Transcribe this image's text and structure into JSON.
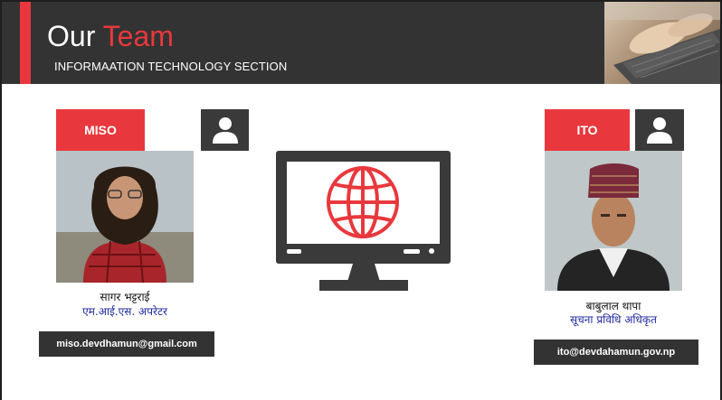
{
  "header": {
    "title_part1": "Our",
    "title_part2": "Team",
    "subtitle": "INFORMAATION TECHNOLOGY SECTION",
    "accent_color": "#e8383d",
    "background_color": "#333333"
  },
  "center_graphic": {
    "icon": "monitor-globe-icon"
  },
  "members": [
    {
      "role": "MISO",
      "icon": "user-icon",
      "name": "सागर भट्टराई",
      "designation": "एम.आई.एस. अपरेटर",
      "email": "miso.devdhamun@gmail.com"
    },
    {
      "role": "ITO",
      "icon": "user-icon",
      "name": "बाबुलाल थापा",
      "designation": "सूचना प्रविधि अधिकृत",
      "email": "ito@devdahamun.gov.np"
    }
  ]
}
